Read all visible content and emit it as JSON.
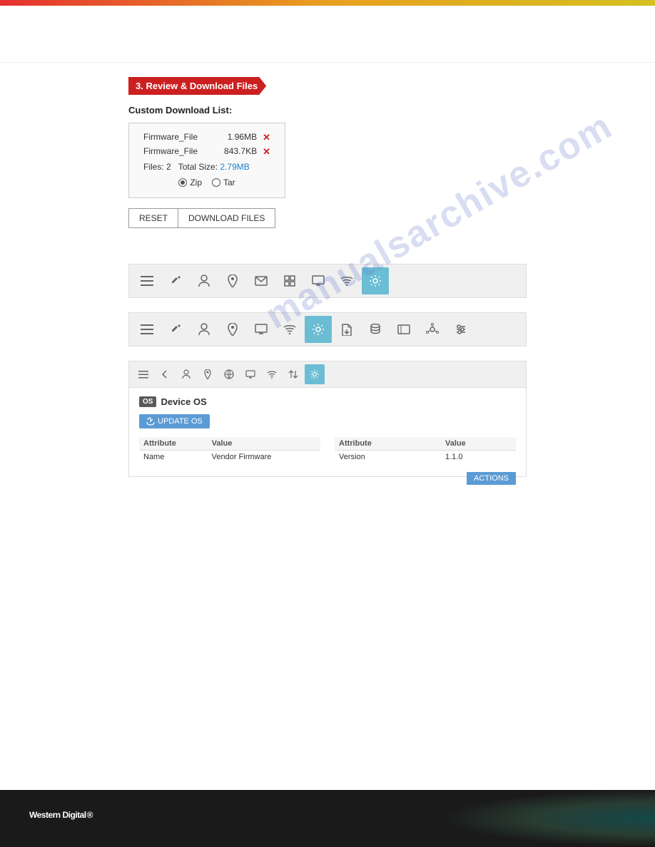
{
  "topBar": {
    "colors": [
      "#e53030",
      "#e8a020",
      "#d4c020"
    ]
  },
  "section": {
    "title": "3. Review & Download Files",
    "customDownloadLabel": "Custom Download List:"
  },
  "downloadList": {
    "files": [
      {
        "name": "Firmware_File",
        "size": "1.96MB"
      },
      {
        "name": "Firmware_File",
        "size": "843.7KB"
      }
    ],
    "filesCount": "2",
    "totalSize": "2.79MB",
    "formats": [
      {
        "label": "Zip",
        "selected": true
      },
      {
        "label": "Tar",
        "selected": false
      }
    ]
  },
  "buttons": {
    "reset": "RESET",
    "downloadFiles": "DOWNLOAD FILES"
  },
  "toolbar1": {
    "icons": [
      "menu",
      "tools",
      "person",
      "location",
      "email",
      "grid",
      "monitor",
      "wifi",
      "settings-active"
    ]
  },
  "toolbar2": {
    "icons": [
      "menu",
      "tools",
      "person",
      "location",
      "monitor",
      "wifi",
      "settings-active",
      "file-export",
      "database",
      "display",
      "network",
      "sliders"
    ]
  },
  "toolbar3": {
    "icons": [
      "menu",
      "arrow-left",
      "person",
      "location",
      "globe",
      "monitor",
      "wifi",
      "arrows",
      "settings-active"
    ]
  },
  "deviceOS": {
    "osBadge": "OS",
    "title": "Device OS",
    "updateButton": "UPDATE OS",
    "leftTable": {
      "headers": [
        "Attribute",
        "Value"
      ],
      "rows": [
        [
          "Name",
          "Vendor Firmware"
        ]
      ]
    },
    "rightTable": {
      "headers": [
        "Attribute",
        "Value"
      ],
      "rows": [
        [
          "Version",
          "1.1.0"
        ]
      ]
    },
    "actionsButton": "ACTIONS"
  },
  "watermark": "manualsarchive.com",
  "footer": {
    "brand": "Western Digital",
    "trademark": "®"
  }
}
